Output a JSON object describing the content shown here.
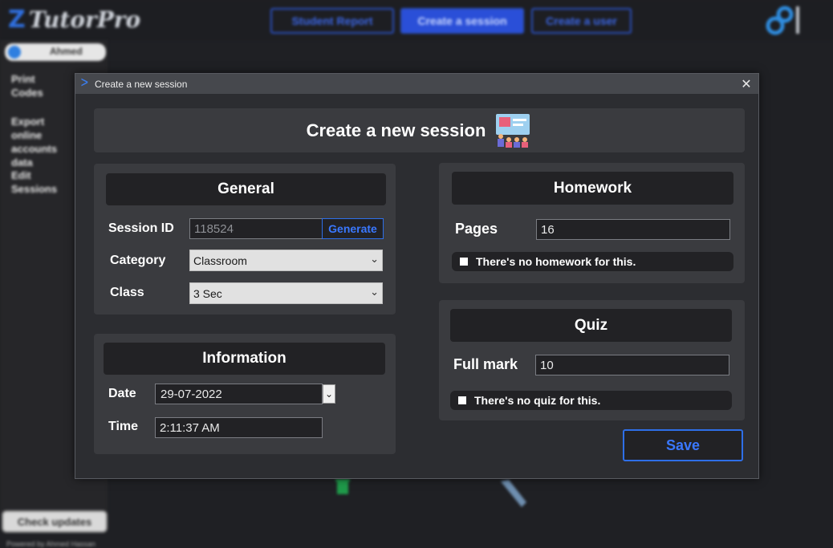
{
  "app": {
    "logo_mark": "Z",
    "logo_text": "TutorPro",
    "nav": [
      {
        "label": "Student Report",
        "active": false
      },
      {
        "label": "Create a session",
        "active": true
      },
      {
        "label": "Create a user",
        "active": false
      }
    ],
    "user_name": "Ahmed",
    "sidebar_items": [
      "Print Codes",
      "Export online accounts data",
      "Edit Sessions"
    ],
    "check_updates": "Check updates",
    "powered_by": "Powered by Ahmed Hassan"
  },
  "dialog": {
    "window_title": "Create a new session",
    "close_glyph": "✕",
    "header_title": "Create a new session",
    "general": {
      "title": "General",
      "session_id_label": "Session ID",
      "session_id_value": "118524",
      "generate_label": "Generate",
      "category_label": "Category",
      "category_value": "Classroom",
      "class_label": "Class",
      "class_value": "3 Sec"
    },
    "information": {
      "title": "Information",
      "date_label": "Date",
      "date_value": "29-07-2022",
      "time_label": "Time",
      "time_value": "2:11:37 AM"
    },
    "homework": {
      "title": "Homework",
      "pages_label": "Pages",
      "pages_value": "16",
      "no_homework_label": "There's no homework for this."
    },
    "quiz": {
      "title": "Quiz",
      "full_mark_label": "Full mark",
      "full_mark_value": "10",
      "no_quiz_label": "There's no quiz for this."
    },
    "save_label": "Save"
  },
  "colors": {
    "accent": "#2e6fe8",
    "panel": "#3a3b3f",
    "panel_head": "#222225",
    "dialog_bg": "#2c2d31"
  }
}
